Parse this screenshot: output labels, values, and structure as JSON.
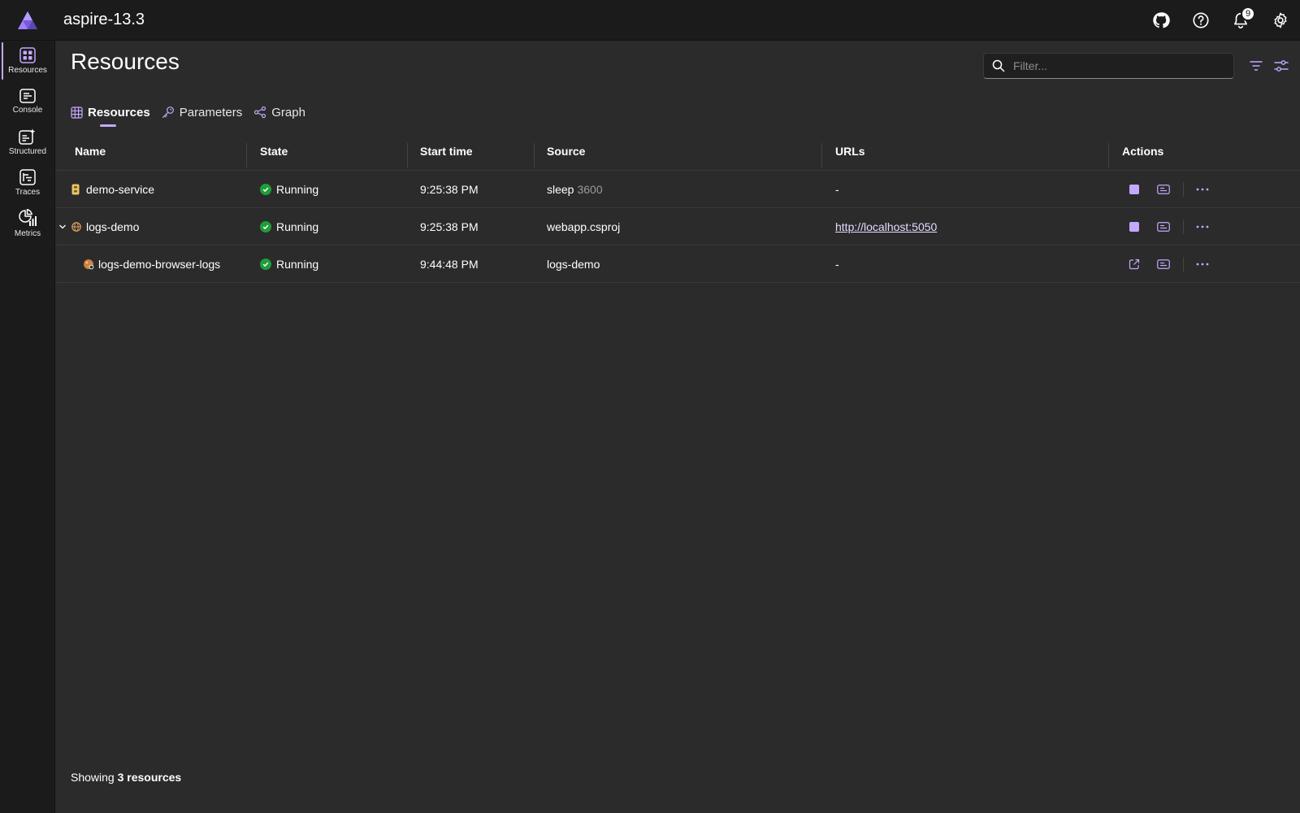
{
  "app": {
    "title": "aspire-13.3",
    "notification_count": "9",
    "accent": "#c5a8ff"
  },
  "sidebar": {
    "items": [
      {
        "label": "Resources",
        "icon": "resources-icon",
        "active": true
      },
      {
        "label": "Console",
        "icon": "console-icon"
      },
      {
        "label": "Structured",
        "icon": "structured-icon"
      },
      {
        "label": "Traces",
        "icon": "traces-icon"
      },
      {
        "label": "Metrics",
        "icon": "metrics-icon"
      }
    ]
  },
  "page": {
    "title": "Resources",
    "filter_placeholder": "Filter..."
  },
  "tabs": [
    {
      "label": "Resources",
      "active": true
    },
    {
      "label": "Parameters"
    },
    {
      "label": "Graph"
    }
  ],
  "grid": {
    "columns": [
      "Name",
      "State",
      "Start time",
      "Source",
      "URLs",
      "Actions"
    ],
    "rows": [
      {
        "name": "demo-service",
        "state": "Running",
        "start_time": "9:25:38 PM",
        "source": "sleep",
        "source_args": "3600",
        "url": "-",
        "first_action": "stop-icon"
      },
      {
        "name": "logs-demo",
        "state": "Running",
        "start_time": "9:25:38 PM",
        "source": "webapp.csproj",
        "source_args": "",
        "url": "http://localhost:5050",
        "first_action": "stop-icon"
      },
      {
        "name": "logs-demo-browser-logs",
        "state": "Running",
        "start_time": "9:44:48 PM",
        "source": "logs-demo",
        "source_args": "",
        "url": "-",
        "first_action": "open-external-icon"
      }
    ]
  },
  "footer": {
    "prefix": "Showing",
    "count_text": "3 resources"
  }
}
